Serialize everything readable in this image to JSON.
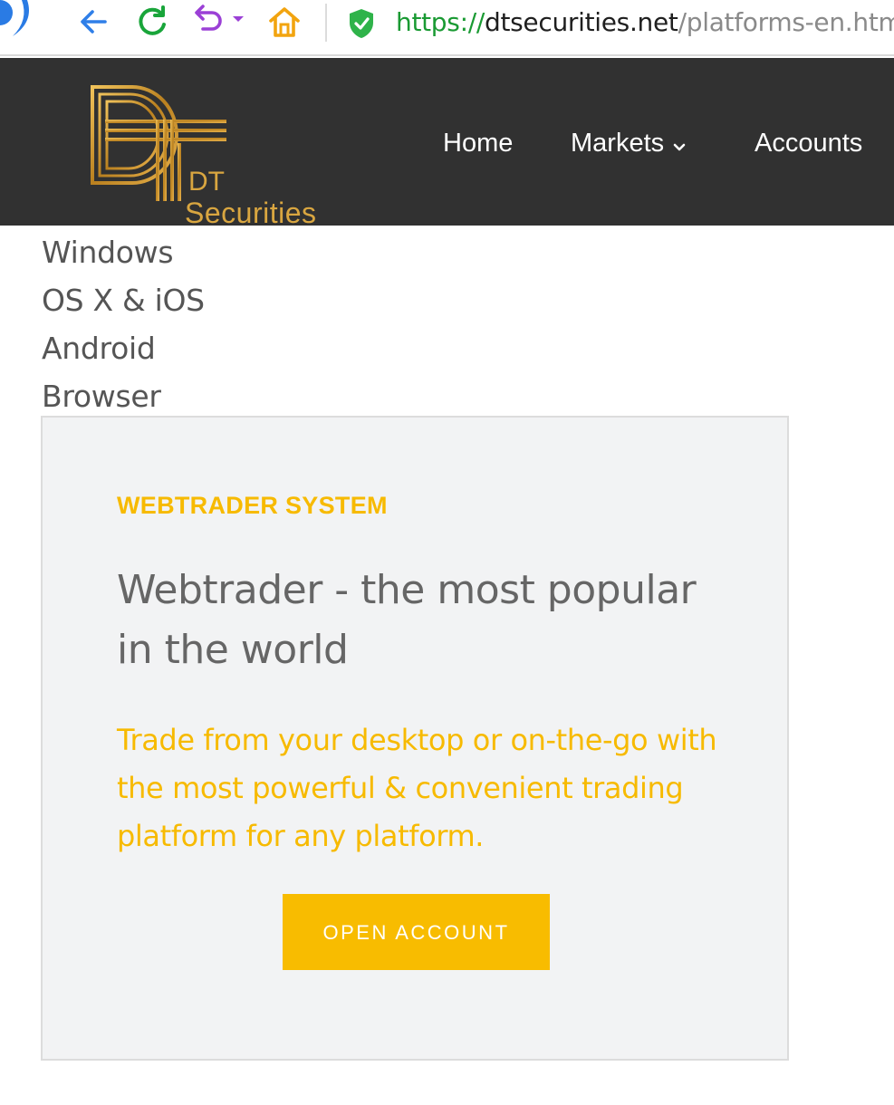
{
  "browser": {
    "url_scheme": "https",
    "url_separator": "://",
    "url_host": "dtsecurities.net",
    "url_path": "/platforms-en.html",
    "icons": [
      "logo-icon",
      "back-icon",
      "refresh-icon",
      "undo-icon",
      "dropdown-icon",
      "home-icon",
      "shield-icon"
    ],
    "colors": {
      "scheme": "#1a9a33",
      "host": "#1f1f1f",
      "path": "#8a8a8a"
    }
  },
  "header": {
    "logo_dt": "DT",
    "logo_securities": "Securities",
    "nav": [
      {
        "label": "Home"
      },
      {
        "label": "Markets"
      },
      {
        "label": "Accounts"
      }
    ],
    "colors": {
      "background": "#313131",
      "logo_gold": "#d9a640"
    }
  },
  "platforms": [
    {
      "label": "Windows"
    },
    {
      "label": "OS X & iOS"
    },
    {
      "label": "Android"
    },
    {
      "label": "Browser"
    }
  ],
  "card": {
    "kicker": "WEBTRADER SYSTEM",
    "title": "Webtrader - the most popular in the world",
    "description": "Trade from your desktop or on-the-go with the most powerful & convenient trading platform for any platform.",
    "cta_label": "OPEN ACCOUNT",
    "colors": {
      "accent": "#f7ba00",
      "title": "#666666",
      "background": "#f2f3f4"
    }
  }
}
